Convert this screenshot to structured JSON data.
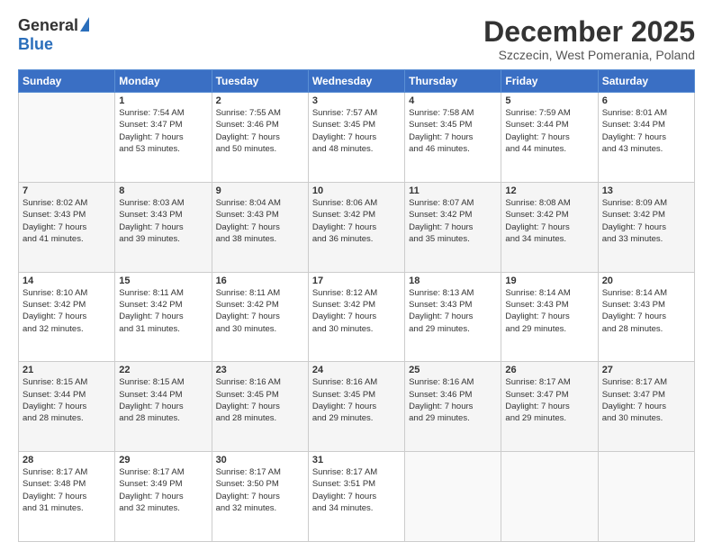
{
  "header": {
    "logo_general": "General",
    "logo_blue": "Blue",
    "title": "December 2025",
    "location": "Szczecin, West Pomerania, Poland"
  },
  "days_of_week": [
    "Sunday",
    "Monday",
    "Tuesday",
    "Wednesday",
    "Thursday",
    "Friday",
    "Saturday"
  ],
  "weeks": [
    [
      {
        "day": "",
        "info": ""
      },
      {
        "day": "1",
        "info": "Sunrise: 7:54 AM\nSunset: 3:47 PM\nDaylight: 7 hours\nand 53 minutes."
      },
      {
        "day": "2",
        "info": "Sunrise: 7:55 AM\nSunset: 3:46 PM\nDaylight: 7 hours\nand 50 minutes."
      },
      {
        "day": "3",
        "info": "Sunrise: 7:57 AM\nSunset: 3:45 PM\nDaylight: 7 hours\nand 48 minutes."
      },
      {
        "day": "4",
        "info": "Sunrise: 7:58 AM\nSunset: 3:45 PM\nDaylight: 7 hours\nand 46 minutes."
      },
      {
        "day": "5",
        "info": "Sunrise: 7:59 AM\nSunset: 3:44 PM\nDaylight: 7 hours\nand 44 minutes."
      },
      {
        "day": "6",
        "info": "Sunrise: 8:01 AM\nSunset: 3:44 PM\nDaylight: 7 hours\nand 43 minutes."
      }
    ],
    [
      {
        "day": "7",
        "info": "Sunrise: 8:02 AM\nSunset: 3:43 PM\nDaylight: 7 hours\nand 41 minutes."
      },
      {
        "day": "8",
        "info": "Sunrise: 8:03 AM\nSunset: 3:43 PM\nDaylight: 7 hours\nand 39 minutes."
      },
      {
        "day": "9",
        "info": "Sunrise: 8:04 AM\nSunset: 3:43 PM\nDaylight: 7 hours\nand 38 minutes."
      },
      {
        "day": "10",
        "info": "Sunrise: 8:06 AM\nSunset: 3:42 PM\nDaylight: 7 hours\nand 36 minutes."
      },
      {
        "day": "11",
        "info": "Sunrise: 8:07 AM\nSunset: 3:42 PM\nDaylight: 7 hours\nand 35 minutes."
      },
      {
        "day": "12",
        "info": "Sunrise: 8:08 AM\nSunset: 3:42 PM\nDaylight: 7 hours\nand 34 minutes."
      },
      {
        "day": "13",
        "info": "Sunrise: 8:09 AM\nSunset: 3:42 PM\nDaylight: 7 hours\nand 33 minutes."
      }
    ],
    [
      {
        "day": "14",
        "info": "Sunrise: 8:10 AM\nSunset: 3:42 PM\nDaylight: 7 hours\nand 32 minutes."
      },
      {
        "day": "15",
        "info": "Sunrise: 8:11 AM\nSunset: 3:42 PM\nDaylight: 7 hours\nand 31 minutes."
      },
      {
        "day": "16",
        "info": "Sunrise: 8:11 AM\nSunset: 3:42 PM\nDaylight: 7 hours\nand 30 minutes."
      },
      {
        "day": "17",
        "info": "Sunrise: 8:12 AM\nSunset: 3:42 PM\nDaylight: 7 hours\nand 30 minutes."
      },
      {
        "day": "18",
        "info": "Sunrise: 8:13 AM\nSunset: 3:43 PM\nDaylight: 7 hours\nand 29 minutes."
      },
      {
        "day": "19",
        "info": "Sunrise: 8:14 AM\nSunset: 3:43 PM\nDaylight: 7 hours\nand 29 minutes."
      },
      {
        "day": "20",
        "info": "Sunrise: 8:14 AM\nSunset: 3:43 PM\nDaylight: 7 hours\nand 28 minutes."
      }
    ],
    [
      {
        "day": "21",
        "info": "Sunrise: 8:15 AM\nSunset: 3:44 PM\nDaylight: 7 hours\nand 28 minutes."
      },
      {
        "day": "22",
        "info": "Sunrise: 8:15 AM\nSunset: 3:44 PM\nDaylight: 7 hours\nand 28 minutes."
      },
      {
        "day": "23",
        "info": "Sunrise: 8:16 AM\nSunset: 3:45 PM\nDaylight: 7 hours\nand 28 minutes."
      },
      {
        "day": "24",
        "info": "Sunrise: 8:16 AM\nSunset: 3:45 PM\nDaylight: 7 hours\nand 29 minutes."
      },
      {
        "day": "25",
        "info": "Sunrise: 8:16 AM\nSunset: 3:46 PM\nDaylight: 7 hours\nand 29 minutes."
      },
      {
        "day": "26",
        "info": "Sunrise: 8:17 AM\nSunset: 3:47 PM\nDaylight: 7 hours\nand 29 minutes."
      },
      {
        "day": "27",
        "info": "Sunrise: 8:17 AM\nSunset: 3:47 PM\nDaylight: 7 hours\nand 30 minutes."
      }
    ],
    [
      {
        "day": "28",
        "info": "Sunrise: 8:17 AM\nSunset: 3:48 PM\nDaylight: 7 hours\nand 31 minutes."
      },
      {
        "day": "29",
        "info": "Sunrise: 8:17 AM\nSunset: 3:49 PM\nDaylight: 7 hours\nand 32 minutes."
      },
      {
        "day": "30",
        "info": "Sunrise: 8:17 AM\nSunset: 3:50 PM\nDaylight: 7 hours\nand 32 minutes."
      },
      {
        "day": "31",
        "info": "Sunrise: 8:17 AM\nSunset: 3:51 PM\nDaylight: 7 hours\nand 34 minutes."
      },
      {
        "day": "",
        "info": ""
      },
      {
        "day": "",
        "info": ""
      },
      {
        "day": "",
        "info": ""
      }
    ]
  ]
}
